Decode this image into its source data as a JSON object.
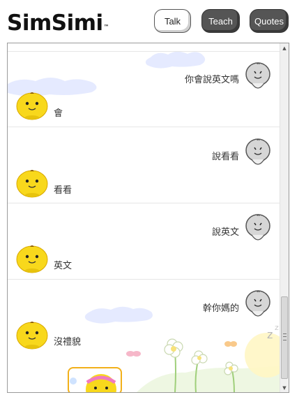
{
  "header": {
    "logo": "SimSimi",
    "logo_tm": "™",
    "tabs": [
      {
        "label": "Talk",
        "active": true
      },
      {
        "label": "Teach",
        "active": false
      },
      {
        "label": "Quotes",
        "active": false
      }
    ]
  },
  "conversation": [
    {
      "user": "你會說英文嗎",
      "bot": "會"
    },
    {
      "user": "說看看",
      "bot": "看看"
    },
    {
      "user": "說英文",
      "bot": "英文"
    },
    {
      "user": "幹你媽的",
      "bot": "沒禮貌"
    }
  ],
  "icons": {
    "user_avatar": "gray-face-icon",
    "bot_avatar": "yellow-chick-icon",
    "scroll_up": "triangle-up-icon",
    "scroll_down": "triangle-down-icon"
  },
  "colors": {
    "bot_yellow": "#f8d81c",
    "user_gray": "#bdbdbd",
    "tab_dark": "#555555",
    "cloud_blue": "#dfe6ff",
    "card_border": "#f2b01a"
  }
}
